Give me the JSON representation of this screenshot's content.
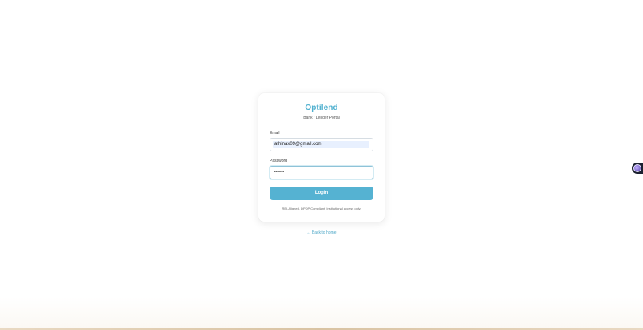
{
  "app": {
    "brand": "Optilend",
    "subtitle": "Bank / Lender Portal"
  },
  "form": {
    "email_label": "Email",
    "email_value": "athinax09@gmail.com",
    "password_label": "Password",
    "password_masked": "••••••",
    "login_label": "Login",
    "footnote": "RBI-Aligned. DPDP Compliant. Institutional access only."
  },
  "nav": {
    "back_label": "← Back to home"
  },
  "widgets": {
    "floating_icon": "assistant-orb-icon"
  },
  "colors": {
    "accent": "#4fb0cf",
    "button": "#55b2d2",
    "autofill": "#e8f0fe"
  }
}
